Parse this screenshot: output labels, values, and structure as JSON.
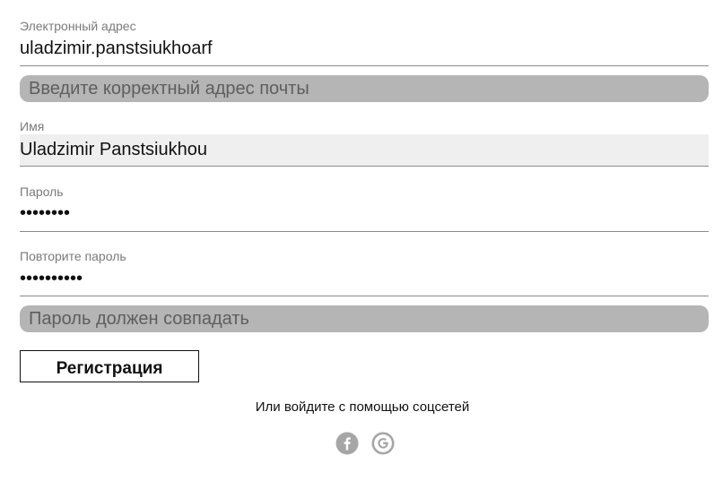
{
  "form": {
    "email": {
      "label": "Электронный адрес",
      "value": "uladzimir.panstsiukhoarf",
      "error": "Введите корректный адрес почты"
    },
    "name": {
      "label": "Имя",
      "value": "Uladzimir Panstsiukhou"
    },
    "password": {
      "label": "Пароль",
      "value": "••••••••"
    },
    "password_repeat": {
      "label": "Повторите пароль",
      "value": "••••••••••",
      "error": "Пароль должен совпадать"
    },
    "submit_label": "Регистрация",
    "social_prompt": "Или войдите с помощью соцсетей",
    "social": [
      {
        "icon": "facebook-icon",
        "letter": "f"
      },
      {
        "icon": "google-icon",
        "letter": "G"
      }
    ]
  },
  "colors": {
    "error_bg": "#b5b5b5",
    "error_text": "#5e5e5e",
    "label": "#7a7a7a",
    "underline": "#8a8a8a",
    "name_bg": "#efefef",
    "social_icon": "#a6a6a6"
  }
}
